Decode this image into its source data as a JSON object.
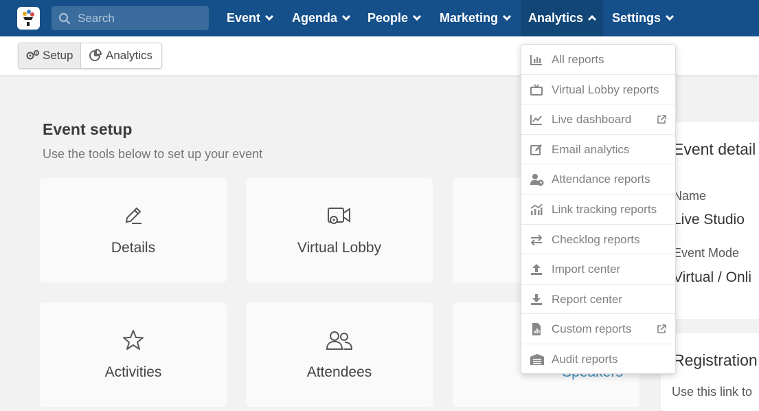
{
  "search": {
    "placeholder": "Search"
  },
  "nav": [
    {
      "label": "Event"
    },
    {
      "label": "Agenda"
    },
    {
      "label": "People"
    },
    {
      "label": "Marketing"
    },
    {
      "label": "Analytics"
    },
    {
      "label": "Settings"
    }
  ],
  "subnav": {
    "setup": "Setup",
    "analytics": "Analytics"
  },
  "main": {
    "title": "Event setup",
    "subtitle": "Use the tools below to set up your event",
    "cards": [
      {
        "label": "Details",
        "icon": "pencil-icon"
      },
      {
        "label": "Virtual Lobby",
        "icon": "video-camera-gear-icon"
      },
      {
        "label": "Activities",
        "icon": "star-icon"
      },
      {
        "label": "Attendees",
        "icon": "users-icon"
      },
      {
        "label": "Speakers"
      }
    ]
  },
  "right": {
    "details_title": "Event detail",
    "name_label": "Name",
    "name_value": "Live Studio",
    "mode_label": "Event Mode",
    "mode_value": "Virtual / Onli",
    "registration_title": "Registration",
    "registration_text": "Use this link to"
  },
  "analytics_menu": [
    {
      "label": "All reports",
      "icon": "bar-chart-icon"
    },
    {
      "label": "Virtual Lobby reports",
      "icon": "tv-icon"
    },
    {
      "label": "Live dashboard",
      "icon": "line-chart-icon",
      "external": true
    },
    {
      "label": "Email analytics",
      "icon": "edit-icon"
    },
    {
      "label": "Attendance reports",
      "icon": "user-clock-icon"
    },
    {
      "label": "Link tracking reports",
      "icon": "chart-line-bars-icon"
    },
    {
      "label": "Checklog reports",
      "icon": "exchange-arrows-icon"
    },
    {
      "label": "Import center",
      "icon": "upload-icon"
    },
    {
      "label": "Report center",
      "icon": "download-icon"
    },
    {
      "label": "Custom reports",
      "icon": "file-chart-icon",
      "external": true
    },
    {
      "label": "Audit reports",
      "icon": "warehouse-icon"
    }
  ],
  "colors": {
    "nav_bg": "#15508a",
    "nav_active": "#114677",
    "link": "#3b8fc1",
    "menu_text": "#808080"
  }
}
